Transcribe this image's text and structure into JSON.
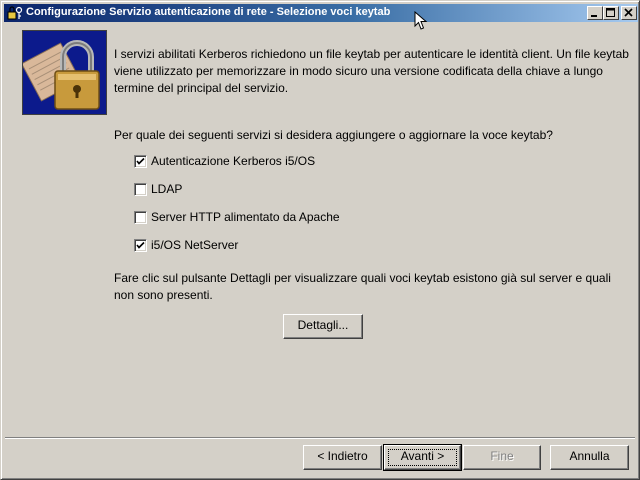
{
  "window": {
    "title": "Configurazione Servizio autenticazione di rete - Selezione voci keytab",
    "controls": [
      "minimize-icon",
      "maximize-icon",
      "close-icon"
    ]
  },
  "content": {
    "intro_text": "I servizi abilitati Kerberos richiedono un file keytab per autenticare le identità client.  Un file keytab viene utilizzato per memorizzare in modo sicuro una versione codificata della chiave a lungo termine del principal del servizio.",
    "question": "Per quale dei seguenti servizi si desidera aggiungere o aggiornare la voce keytab?",
    "services": [
      {
        "label": "Autenticazione Kerberos i5/OS",
        "checked": true
      },
      {
        "label": "LDAP",
        "checked": false
      },
      {
        "label": "Server HTTP alimentato da Apache",
        "checked": false
      },
      {
        "label": "i5/OS NetServer",
        "checked": true
      }
    ],
    "details_text": "Fare clic sul pulsante Dettagli per visualizzare quali voci keytab esistono già sul server e quali non sono presenti.",
    "details_button": "Dettagli..."
  },
  "footer": {
    "back_button": "< Indietro",
    "next_button": "Avanti >",
    "finish_button": "Fine",
    "cancel_button": "Annulla"
  },
  "colors": {
    "title_gradient_start": "#0a246a",
    "title_gradient_end": "#a6caf0",
    "face": "#d4d0c8",
    "image_background": "#0c1a8c"
  }
}
